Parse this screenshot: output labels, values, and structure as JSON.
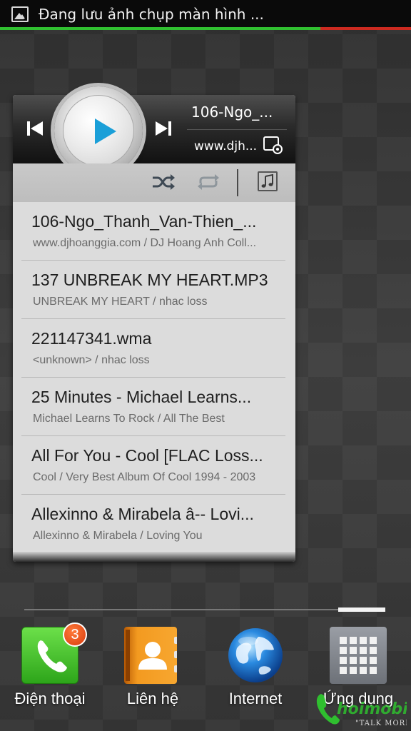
{
  "status_bar": {
    "icon": "image-icon",
    "text": "Đang lưu ảnh chụp màn hình ...",
    "progress": 0.78,
    "colors": {
      "progress": "#30c030",
      "remaining": "#cc2a20"
    }
  },
  "player": {
    "now_playing_title": "106-Ngo_...",
    "now_playing_sub": "www.djh...",
    "icons": {
      "prev": "skip-previous-icon",
      "play": "play-icon",
      "next": "skip-next-icon",
      "settings": "settings-screen-icon",
      "shuffle": "shuffle-icon",
      "repeat": "repeat-icon",
      "library": "music-note-icon"
    },
    "accent_color": "#1a9fd8"
  },
  "tracks": [
    {
      "title": "106-Ngo_Thanh_Van-Thien_...",
      "subtitle": "www.djhoanggia.com / DJ Hoang Anh Coll..."
    },
    {
      "title": "137 UNBREAK MY HEART.MP3",
      "subtitle": "UNBREAK MY HEART / nhac loss"
    },
    {
      "title": "221147341.wma",
      "subtitle": "<unknown> / nhac loss"
    },
    {
      "title": "25 Minutes - Michael Learns...",
      "subtitle": "Michael Learns To Rock / All The Best"
    },
    {
      "title": "All For You - Cool [FLAC Loss...",
      "subtitle": "Cool / Very Best Album Of Cool 1994 - 2003"
    },
    {
      "title": "Allexinno & Mirabela â-- Lovi...",
      "subtitle": "Allexinno & Mirabela / Loving You"
    }
  ],
  "dock": [
    {
      "label": "Điện thoại",
      "icon": "phone-icon",
      "badge": "3"
    },
    {
      "label": "Liên hệ",
      "icon": "contacts-icon"
    },
    {
      "label": "Internet",
      "icon": "globe-icon"
    },
    {
      "label": "Ứng dụng",
      "icon": "apps-grid-icon"
    }
  ],
  "watermark": {
    "text_main": "hoimobile",
    "text_sub": "TALK MORE"
  }
}
